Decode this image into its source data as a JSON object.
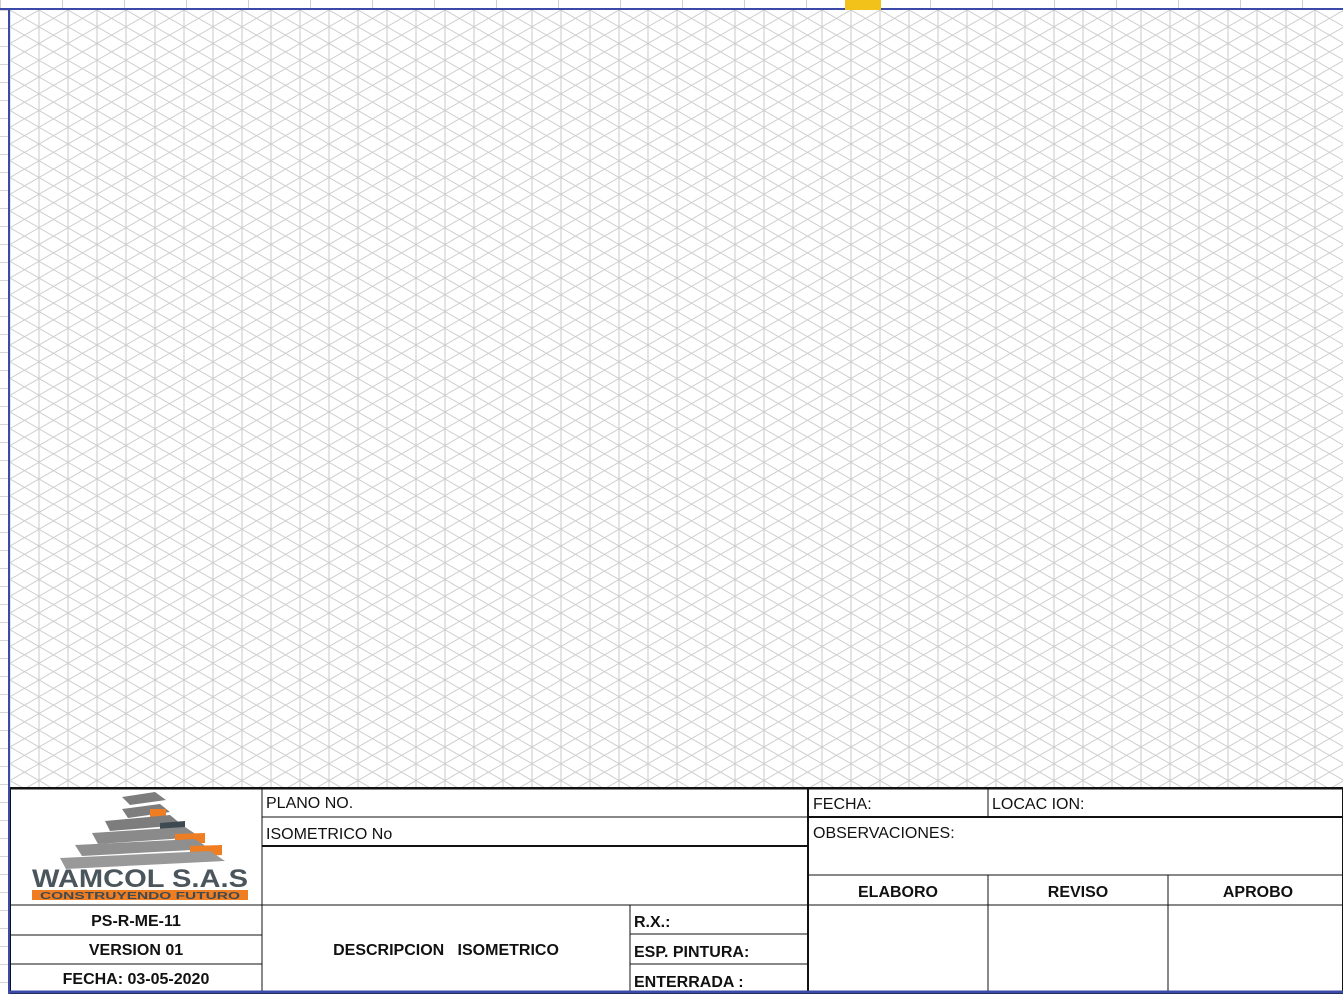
{
  "title_block": {
    "logo": {
      "company": "WAMCOL S.A.S",
      "tagline": "CONSTRUYENDO FUTURO",
      "colors": {
        "gray": "#7d7d7d",
        "orange": "#ef7d22",
        "dark": "#3d4a52"
      }
    },
    "doc_code": "PS-R-ME-11",
    "version": "VERSION 01",
    "doc_date": "FECHA: 03-05-2020",
    "plano_no": "PLANO NO.",
    "isometrico_no": "ISOMETRICO No",
    "descripcion": "DESCRIPCION   ISOMETRICO",
    "rx": "R.X.:",
    "esp_pintura": "ESP. PINTURA:",
    "enterrada": "ENTERRADA :",
    "fecha": "FECHA:",
    "locacion": "LOCAC ION:",
    "observaciones": "OBSERVACIONES:",
    "signatures": [
      "ELABORO",
      "REVISO",
      "APROBO"
    ]
  },
  "colors": {
    "grid_line": "#c9c9c9",
    "frame": "#3b4aa8",
    "selection": "#f2c21b"
  }
}
